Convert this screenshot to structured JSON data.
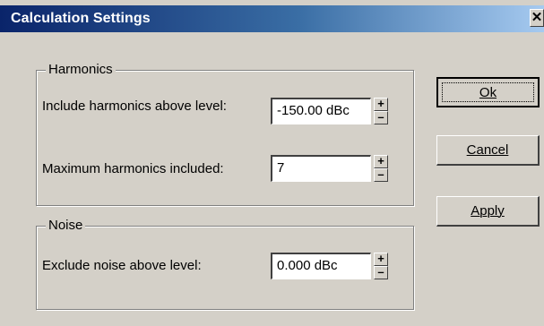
{
  "window": {
    "title": "Calculation Settings",
    "close_glyph": "✕"
  },
  "harmonics": {
    "group_label": "Harmonics",
    "level_label": "Include harmonics above level:",
    "level_value": "-150.00 dBc",
    "max_label": "Maximum harmonics included:",
    "max_value": "7"
  },
  "noise": {
    "group_label": "Noise",
    "level_label": "Exclude noise above level:",
    "level_value": "0.000 dBc"
  },
  "spin": {
    "up_glyph": "+",
    "down_glyph": "–"
  },
  "buttons": {
    "ok": "Ok",
    "cancel": "Cancel",
    "apply": "Apply"
  },
  "icons": [
    "close-icon",
    "spin-up-icon",
    "spin-down-icon"
  ]
}
